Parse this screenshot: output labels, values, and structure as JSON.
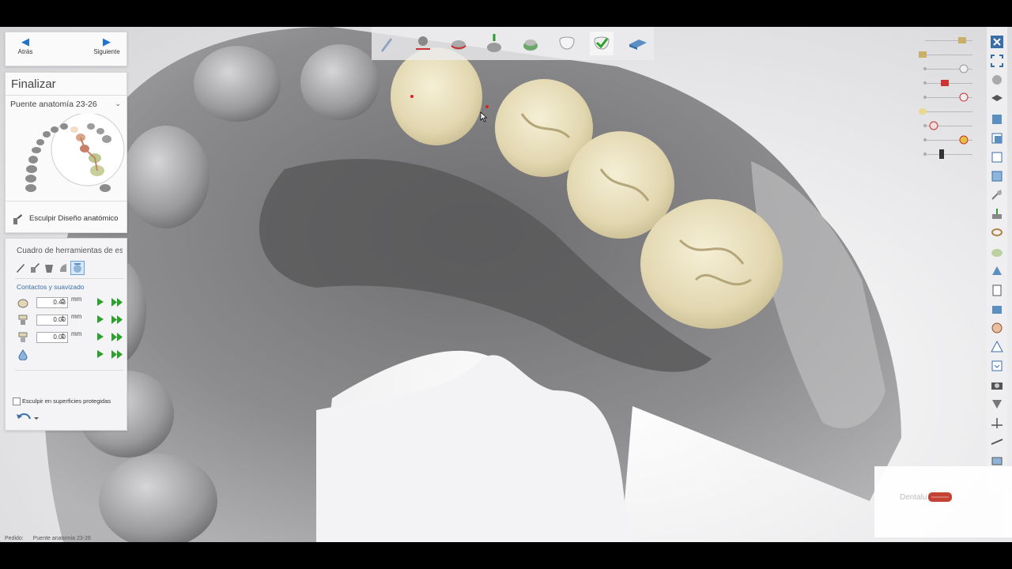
{
  "nav": {
    "back_label": "Atrás",
    "next_label": "Siguiente"
  },
  "finalize": {
    "title": "Finalizar",
    "case_dropdown": "Puente anatomía 23-26",
    "sculpt_label": "Esculpir Diseño anatómico"
  },
  "toolbox": {
    "title": "Cuadro de herramientas de escultura",
    "section": "Contactos y suavizado",
    "rows": [
      {
        "value": "0.43",
        "unit": "mm"
      },
      {
        "value": "0.00",
        "unit": "mm"
      },
      {
        "value": "0.00",
        "unit": "mm"
      }
    ],
    "checkbox_label": "Esculpir en superficies protegidas",
    "checkbox_checked": false
  },
  "watermark": {
    "text": "Dentalu       3D"
  },
  "status": {
    "label": "Pedido:",
    "value": "Puente anatomía 23-26"
  },
  "colors": {
    "crown": "#e8dfbd",
    "model": "#8a8a8a",
    "accent": "#1f74c9",
    "play": "#2da12d",
    "toolbox_section": "#3a6ea8"
  },
  "icons": {
    "top_steps": [
      "scan-icon",
      "margin-tool-icon",
      "margin-line-icon",
      "insertion-icon",
      "crown-design-icon",
      "anatomy-tooth-icon",
      "finalize-check-icon",
      "mill-block-icon"
    ],
    "right_tools": [
      "close-icon",
      "fullscreen-icon",
      "view-rotate-icon",
      "preset-view-icon",
      "cube-front-icon",
      "cube-side-icon",
      "cube-top-icon",
      "cube-right-icon",
      "tooth-cross-icon",
      "tooth-section-icon",
      "ring-icon",
      "arch-icon",
      "cap-icon",
      "clipboard-icon",
      "box-3d-icon",
      "face-icon",
      "warning-icon",
      "download-icon",
      "camera-icon",
      "shield-icon",
      "axis-icon",
      "measure-icon",
      "screenshot-icon"
    ]
  }
}
